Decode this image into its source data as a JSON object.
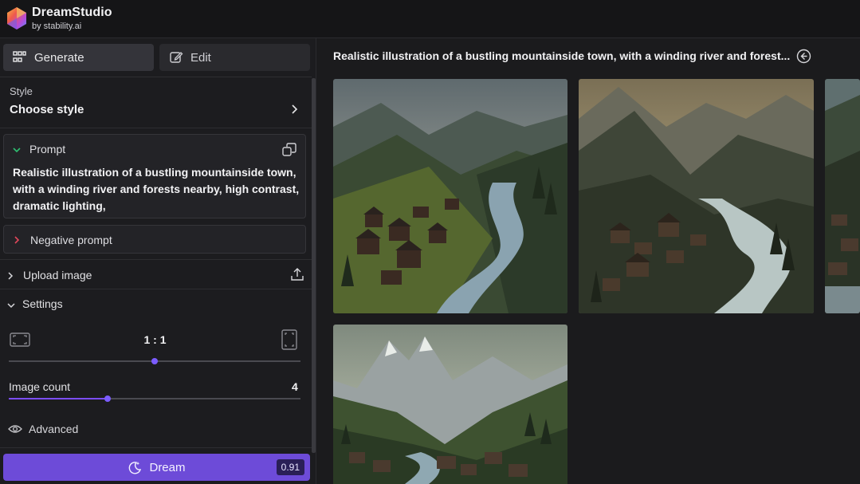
{
  "header": {
    "brand_title": "DreamStudio",
    "brand_subtitle": "by stability.ai",
    "logo_icon": "hexagon-gradient-logo"
  },
  "tabs": [
    {
      "label": "Generate",
      "icon": "grid-icon",
      "active": true
    },
    {
      "label": "Edit",
      "icon": "edit-icon",
      "active": false
    }
  ],
  "style": {
    "label": "Style",
    "value": "Choose style"
  },
  "prompt": {
    "title": "Prompt",
    "text": "Realistic illustration of a bustling mountainside town, with a winding river and forests nearby, high contrast, dramatic lighting,"
  },
  "negative_prompt": {
    "title": "Negative prompt"
  },
  "upload": {
    "label": "Upload image"
  },
  "settings": {
    "label": "Settings",
    "aspect_ratio": "1 : 1",
    "aspect_ratio_slider": 0.5,
    "image_count_label": "Image count",
    "image_count": "4",
    "image_count_slider": 0.34,
    "advanced_label": "Advanced"
  },
  "dream_button": {
    "label": "Dream",
    "credits": "0.91"
  },
  "results": {
    "title": "Realistic illustration of a bustling mountainside town, with a winding river and forest...",
    "images": [
      "mountain-town-river-1",
      "mountain-town-river-2",
      "mountain-town-river-3",
      "mountain-town-river-4"
    ]
  },
  "colors": {
    "accent": "#6d4bd8",
    "background": "#1b1b1d",
    "panel": "#232327"
  }
}
